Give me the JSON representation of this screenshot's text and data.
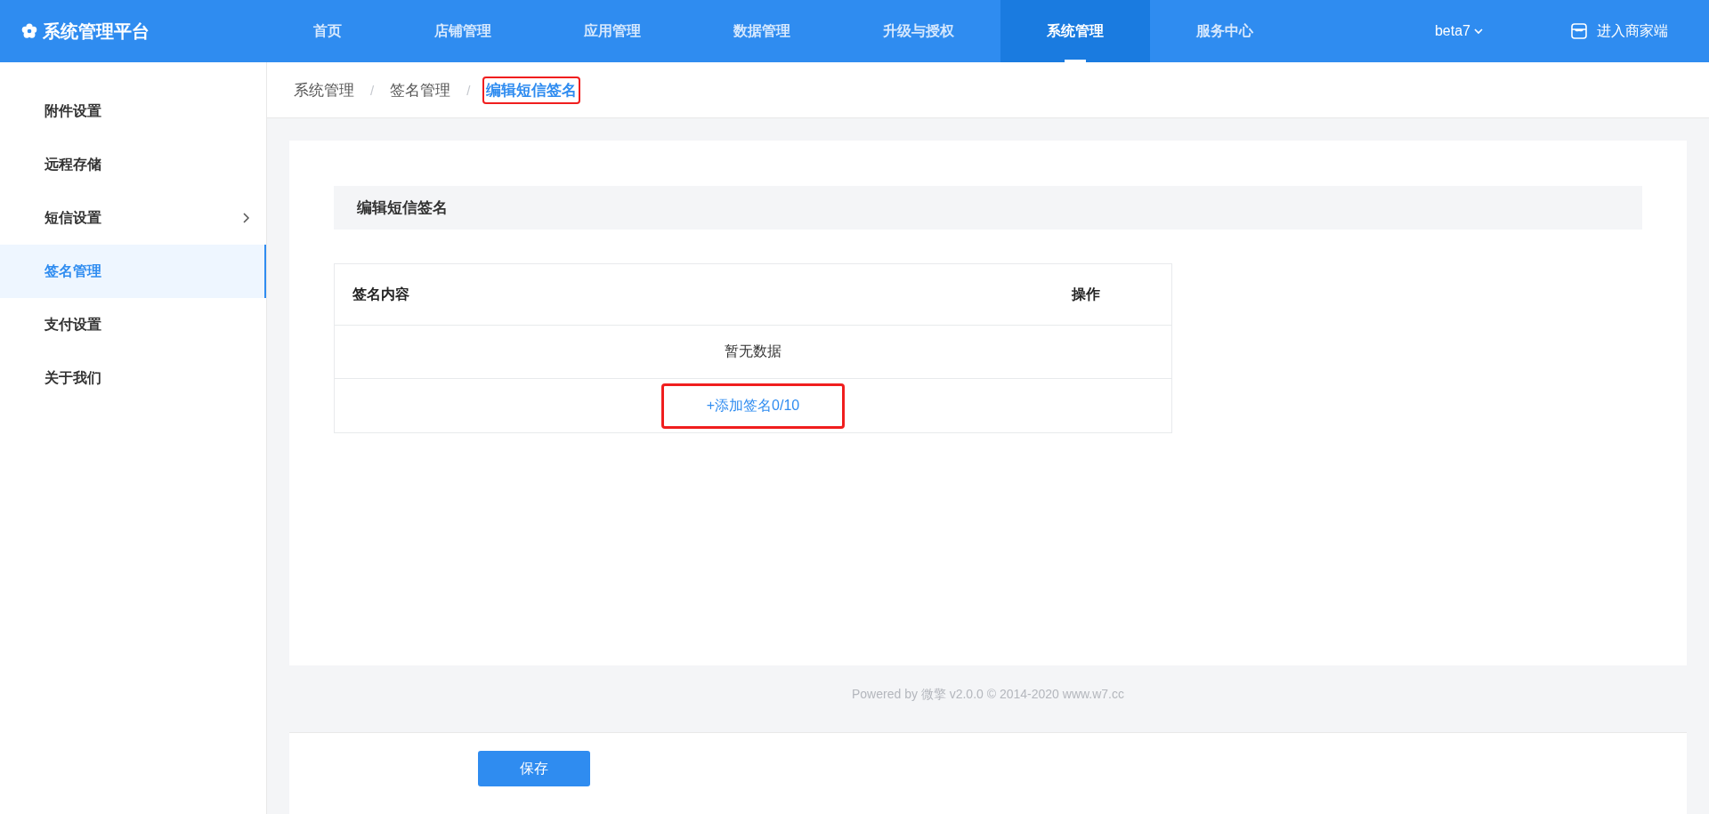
{
  "brand": {
    "title": "系统管理平台"
  },
  "nav": [
    {
      "label": "首页",
      "selected": false
    },
    {
      "label": "店铺管理",
      "selected": false
    },
    {
      "label": "应用管理",
      "selected": false
    },
    {
      "label": "数据管理",
      "selected": false
    },
    {
      "label": "升级与授权",
      "selected": false
    },
    {
      "label": "系统管理",
      "selected": true
    },
    {
      "label": "服务中心",
      "selected": false
    }
  ],
  "version_menu": {
    "label": "beta7"
  },
  "merchant_link": {
    "label": "进入商家端"
  },
  "sidebar": {
    "items": [
      {
        "label": "附件设置",
        "selected": false,
        "has_children": false
      },
      {
        "label": "远程存储",
        "selected": false,
        "has_children": false
      },
      {
        "label": "短信设置",
        "selected": false,
        "has_children": true
      },
      {
        "label": "签名管理",
        "selected": true,
        "has_children": false
      },
      {
        "label": "支付设置",
        "selected": false,
        "has_children": false
      },
      {
        "label": "关于我们",
        "selected": false,
        "has_children": false
      }
    ]
  },
  "breadcrumb_separator": "/",
  "breadcrumb": [
    {
      "label": "系统管理",
      "current": false,
      "highlighted": false
    },
    {
      "label": "签名管理",
      "current": false,
      "highlighted": false
    },
    {
      "label": "编辑短信签名",
      "current": true,
      "highlighted": true
    }
  ],
  "section_title": "编辑短信签名",
  "table": {
    "columns": [
      "签名内容",
      "操作"
    ],
    "empty_text": "暂无数据",
    "add_link": {
      "label": "+添加签名0/10",
      "highlighted": true
    }
  },
  "footer": "Powered by 微擎 v2.0.0 © 2014-2020 www.w7.cc",
  "save_button": {
    "label": "保存"
  }
}
